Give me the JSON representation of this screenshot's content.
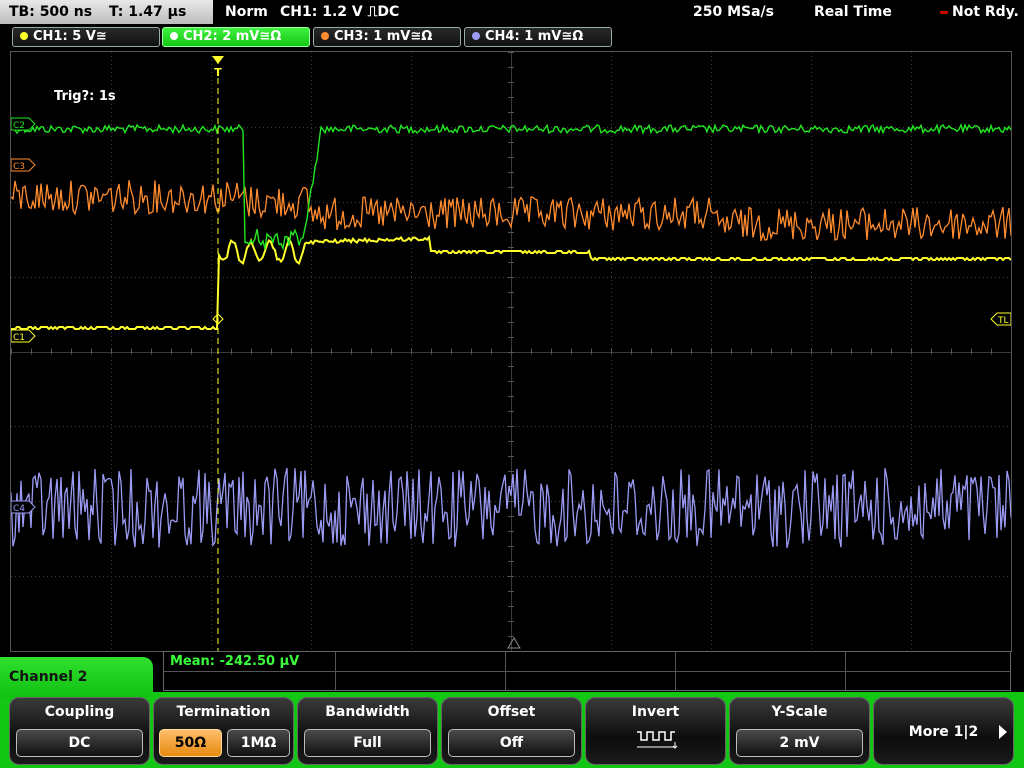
{
  "topbar": {
    "timebase": "TB: 500 ns",
    "trigger_time": "T: 1.47 µs",
    "mode": "Norm",
    "trigger_setting": "CH1: 1.2 V ⎍DC",
    "sample_rate": "250 MSa/s",
    "acq_mode": "Real Time",
    "status": "Not Rdy."
  },
  "channels": [
    {
      "label": "CH1: 5 V≅",
      "color": "#ffff2a",
      "active": false
    },
    {
      "label": "CH2: 2 mV≅Ω",
      "color": "#22e622",
      "active": true
    },
    {
      "label": "CH3: 1 mV≅Ω",
      "color": "#ff8c2e",
      "active": false
    },
    {
      "label": "CH4: 1 mV≅Ω",
      "color": "#9b9bf5",
      "active": false
    }
  ],
  "screen": {
    "trigger_status": "Trig?: 1s",
    "markers": {
      "c1": "C1",
      "c2": "C2",
      "c3": "C3",
      "c4": "C4",
      "trigger_level": "TL",
      "trigger_pos": "T"
    }
  },
  "measurement": {
    "mean": "Mean: -242.50 µV"
  },
  "menu": {
    "title": "Channel 2",
    "coupling": {
      "caption": "Coupling",
      "value": "DC"
    },
    "termination": {
      "caption": "Termination",
      "option_a": "50Ω",
      "option_b": "1MΩ",
      "selected": "50Ω"
    },
    "bandwidth": {
      "caption": "Bandwidth",
      "value": "Full"
    },
    "offset": {
      "caption": "Offset",
      "value": "Off"
    },
    "invert": {
      "caption": "Invert"
    },
    "yscale": {
      "caption": "Y-Scale",
      "value": "2 mV"
    },
    "more": {
      "label": "More 1|2"
    }
  }
}
